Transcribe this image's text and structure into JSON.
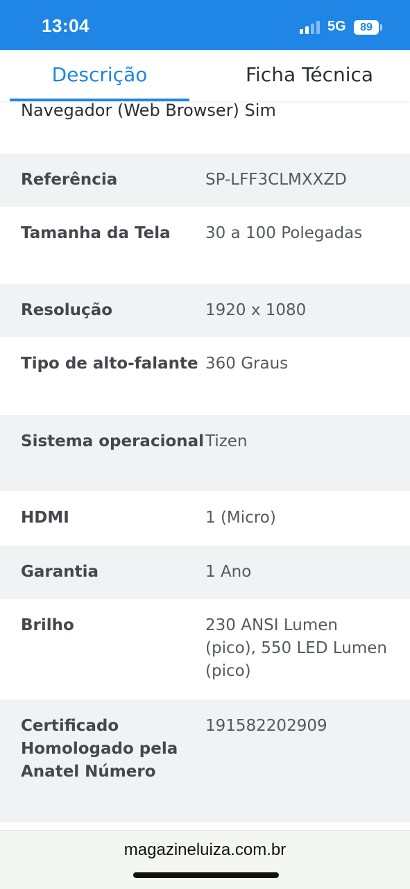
{
  "status_bar": {
    "time": "13:04",
    "network": "5G",
    "battery_level": "89",
    "signal_icon": "cellular-signal-icon",
    "battery_icon": "battery-icon"
  },
  "tabs": [
    {
      "label": "Descrição",
      "active": true
    },
    {
      "label": "Ficha Técnica",
      "active": false
    }
  ],
  "previous_row_text": "Navegador (Web Browser) Sim",
  "specs": [
    {
      "label": "Referência",
      "value": "SP-LFF3CLMXXZD"
    },
    {
      "label": "Tamanha da Tela",
      "value": "30 a 100 Polegadas"
    },
    {
      "label": "Resolução",
      "value": "1920 x 1080"
    },
    {
      "label": "Tipo de alto-falante",
      "value": "360 Graus"
    },
    {
      "label": "Sistema operacional",
      "value": "Tizen"
    },
    {
      "label": "HDMI",
      "value": "1 (Micro)"
    },
    {
      "label": "Garantia",
      "value": "1 Ano"
    },
    {
      "label": "Brilho",
      "value": "230 ANSI Lumen (pico), 550 LED Lumen (pico)"
    },
    {
      "label": "Certificado Homologado pela Anatel Número",
      "value": "191582202909"
    }
  ],
  "browser": {
    "url": "magazineluiza.com.br"
  },
  "colors": {
    "accent": "#1f86e5",
    "row_shaded": "#f1f2f4"
  }
}
